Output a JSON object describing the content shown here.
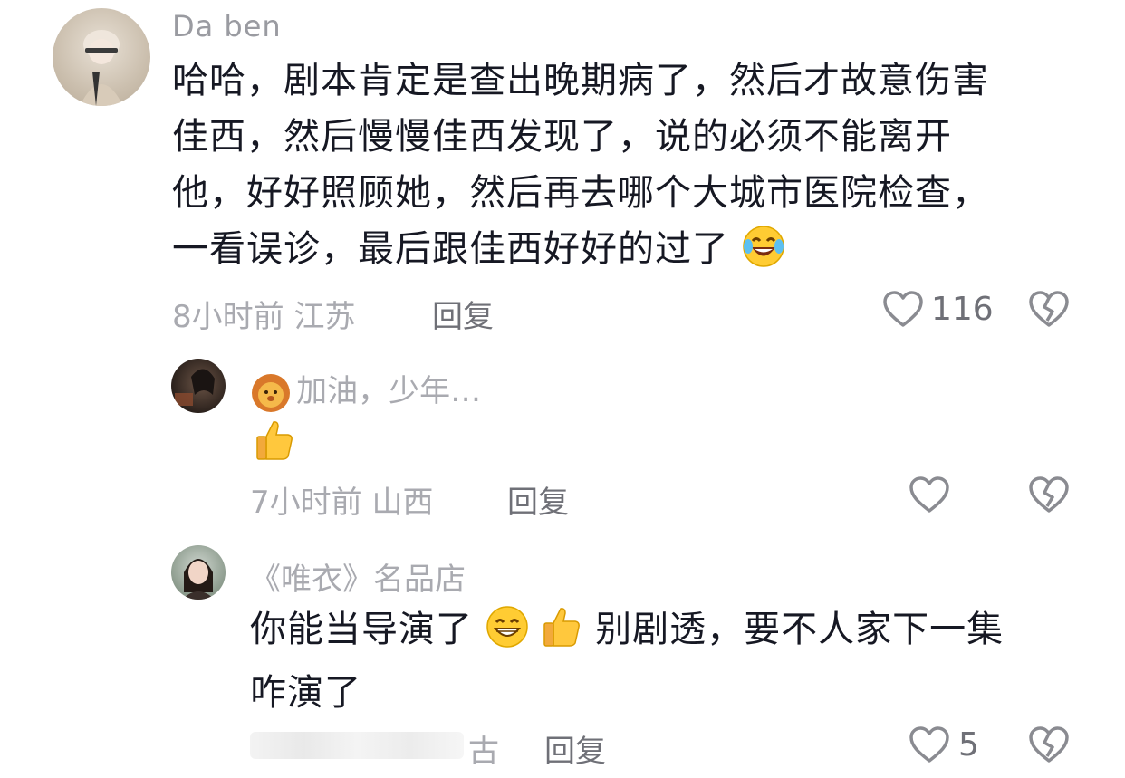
{
  "comment1": {
    "username": "Da   ben",
    "lines": [
      "哈哈，剧本肯定是查出晚期病了，然后才故意伤害",
      "佳西，然后慢慢佳西发现了，说的必须不能离开",
      "他，好好照顾她，然后再去哪个大城市医院检查，",
      "一看误诊，最后跟佳西好好的过了"
    ],
    "emoji": "laughing-tears-emoji",
    "time_location": "8小时前 江苏",
    "reply_label": "回复",
    "like_count": "116"
  },
  "reply1": {
    "username": "加油，少年…",
    "username_emoji": "lion-emoji",
    "content_emoji": "thumbs-up-emoji",
    "time_location": "7小时前 山西",
    "reply_label": "回复"
  },
  "reply2": {
    "username": "《唯衣》名品店",
    "text_part1": "你能当导演了",
    "text_part2": "别剧透，要不人家下一集",
    "text_line2": "咋演了",
    "emojis": [
      "grin-emoji",
      "thumbs-up-emoji"
    ],
    "time_location_tail": "古",
    "reply_label": "回复",
    "like_count": "5"
  },
  "colors": {
    "text": "#161823",
    "meta": "#a9aab0",
    "reply": "#6f7077",
    "icon": "#8a8b91"
  }
}
